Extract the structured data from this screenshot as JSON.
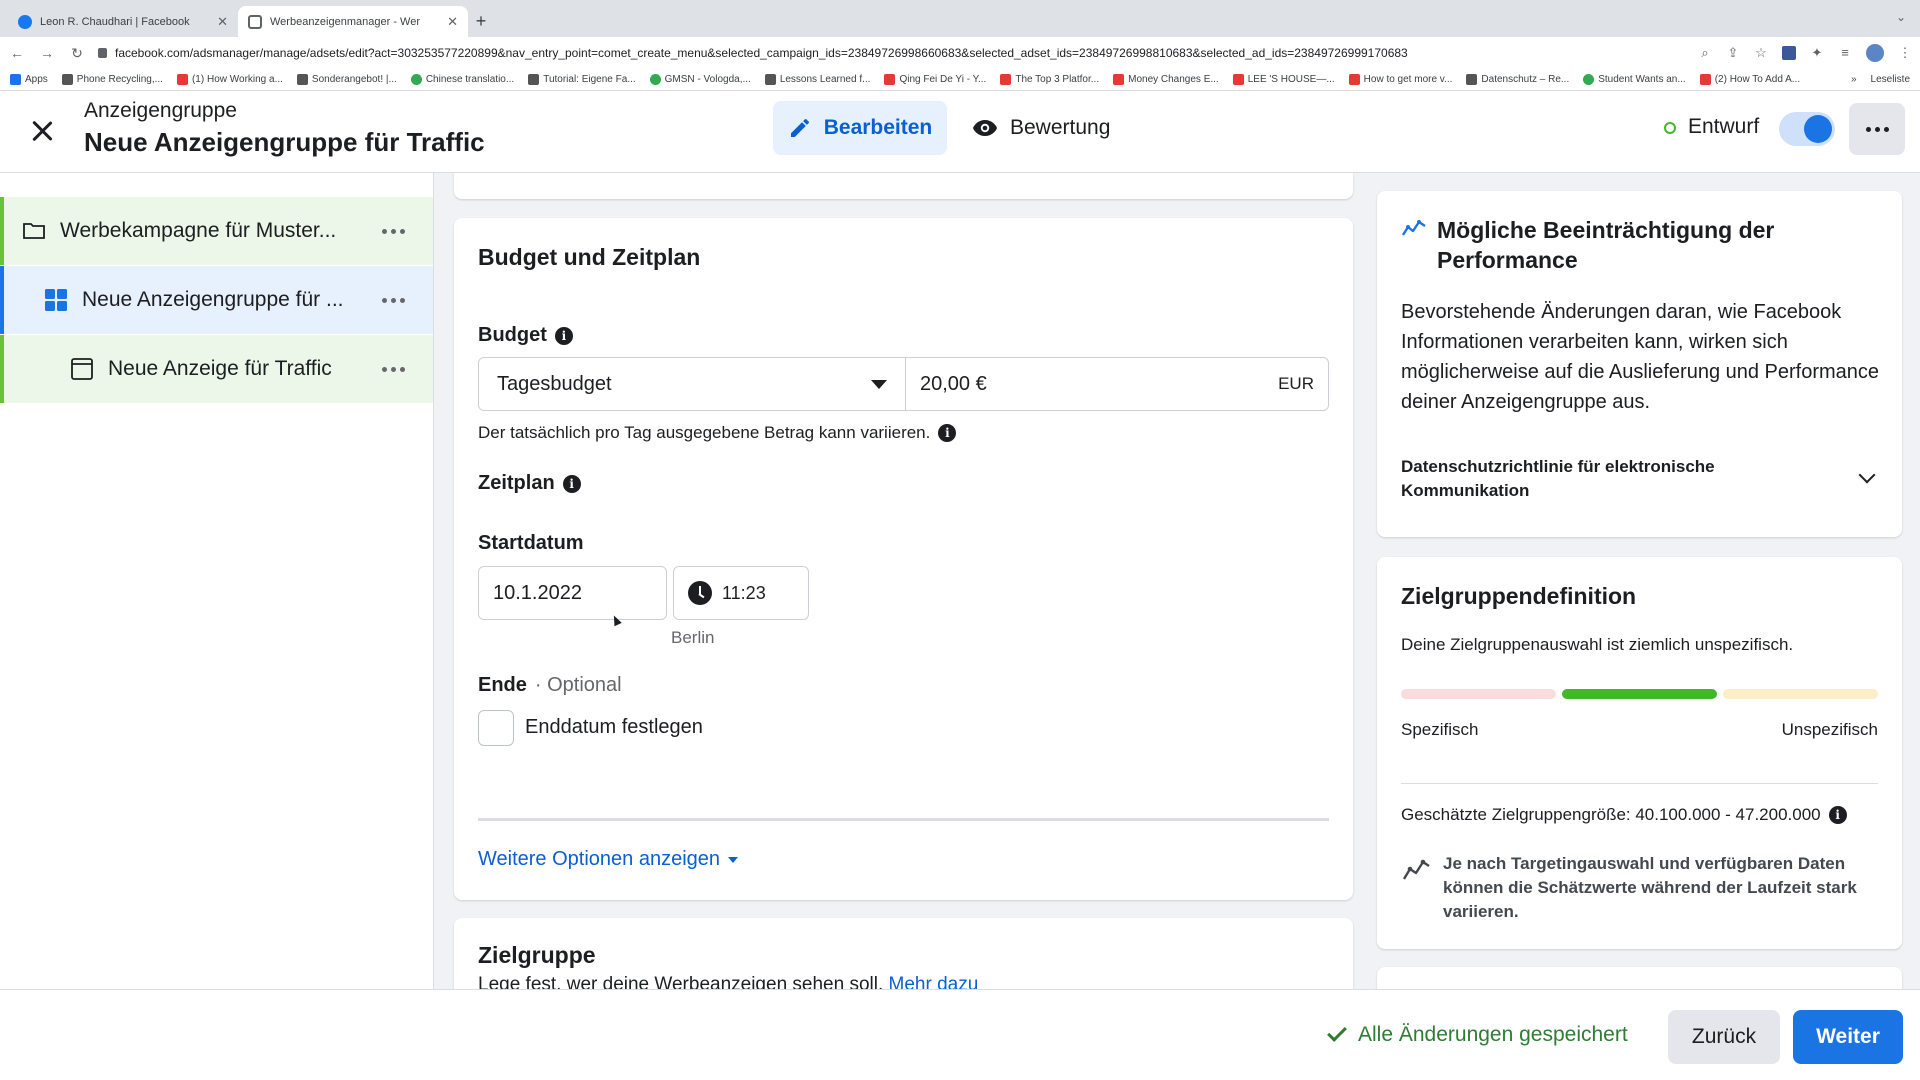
{
  "browser": {
    "tabs": [
      {
        "title": "Leon R. Chaudhari | Facebook",
        "active": false
      },
      {
        "title": "Werbeanzeigenmanager - Wer",
        "active": true
      }
    ],
    "new_tab": "+",
    "url_host": "facebook.com",
    "url_path": "/adsmanager/manage/adsets/edit?act=303253577220899&nav_entry_point=comet_create_menu&selected_campaign_ids=23849726998660683&selected_adset_ids=23849726998810683&selected_ad_ids=23849726999170683",
    "bookmarks": [
      "Apps",
      "Phone Recycling,...",
      "(1) How Working a...",
      "Sonderangebot! |...",
      "Chinese translatio...",
      "Tutorial: Eigene Fa...",
      "GMSN - Vologda,...",
      "Lessons Learned f...",
      "Qing Fei De Yi - Y...",
      "The Top 3 Platfor...",
      "Money Changes E...",
      "LEE 'S HOUSE—...",
      "How to get more v...",
      "Datenschutz – Re...",
      "Student Wants an...",
      "(2) How To Add A..."
    ],
    "bookmarks_more": "»",
    "reading_list": "Leseliste"
  },
  "header": {
    "overline": "Anzeigengruppe",
    "title": "Neue Anzeigengruppe für Traffic",
    "edit_tab": "Bearbeiten",
    "review_tab": "Bewertung",
    "status": "Entwurf",
    "toggle_on": true
  },
  "sidebar": {
    "items": [
      {
        "label": "Werbekampagne für Muster..."
      },
      {
        "label": "Neue Anzeigengruppe für ..."
      },
      {
        "label": "Neue Anzeige für Traffic"
      }
    ]
  },
  "budget": {
    "title": "Budget und Zeitplan",
    "budget_label": "Budget",
    "budget_type": "Tagesbudget",
    "amount": "20,00 €",
    "currency": "EUR",
    "helper": "Der tatsächlich pro Tag ausgegebene Betrag kann variieren.",
    "schedule_label": "Zeitplan",
    "start_label": "Startdatum",
    "start_date": "10.1.2022",
    "start_time": "11:23",
    "timezone": "Berlin",
    "end_label": "Ende",
    "end_optional": "· Optional",
    "end_checkbox": "Enddatum festlegen",
    "end_checked": false,
    "more_options": "Weitere Optionen anzeigen"
  },
  "audience": {
    "title": "Zielgruppe",
    "subtitle": "Lege fest, wer deine Werbeanzeigen sehen soll.",
    "link": "Mehr dazu"
  },
  "performance": {
    "title": "Mögliche Beeinträchtigung der Performance",
    "body": "Bevorstehende Änderungen daran, wie Facebook Informationen verarbeiten kann, wirken sich möglicherweise auf die Auslieferung und Performance deiner Anzeigengruppe aus.",
    "link": "Datenschutzrichtlinie für elektronische Kommunikation"
  },
  "audience_definition": {
    "title": "Zielgruppendefinition",
    "description": "Deine Zielgruppenauswahl ist ziemlich unspezifisch.",
    "meter_colors": [
      "#fbdcdc",
      "#42b72a",
      "#fcefc6"
    ],
    "left_label": "Spezifisch",
    "right_label": "Unspezifisch",
    "size": "Geschätzte Zielgruppengröße: 40.100.000 - 47.200.000",
    "note": "Je nach Targetingauswahl und verfügbaren Daten können die Schätzwerte während der Laufzeit stark variieren."
  },
  "footer": {
    "saved": "Alle Änderungen gespeichert",
    "back": "Zurück",
    "next": "Weiter"
  },
  "colors": {
    "primary": "#1b74e4",
    "link": "#0a5fd3",
    "success": "#42b72a"
  }
}
